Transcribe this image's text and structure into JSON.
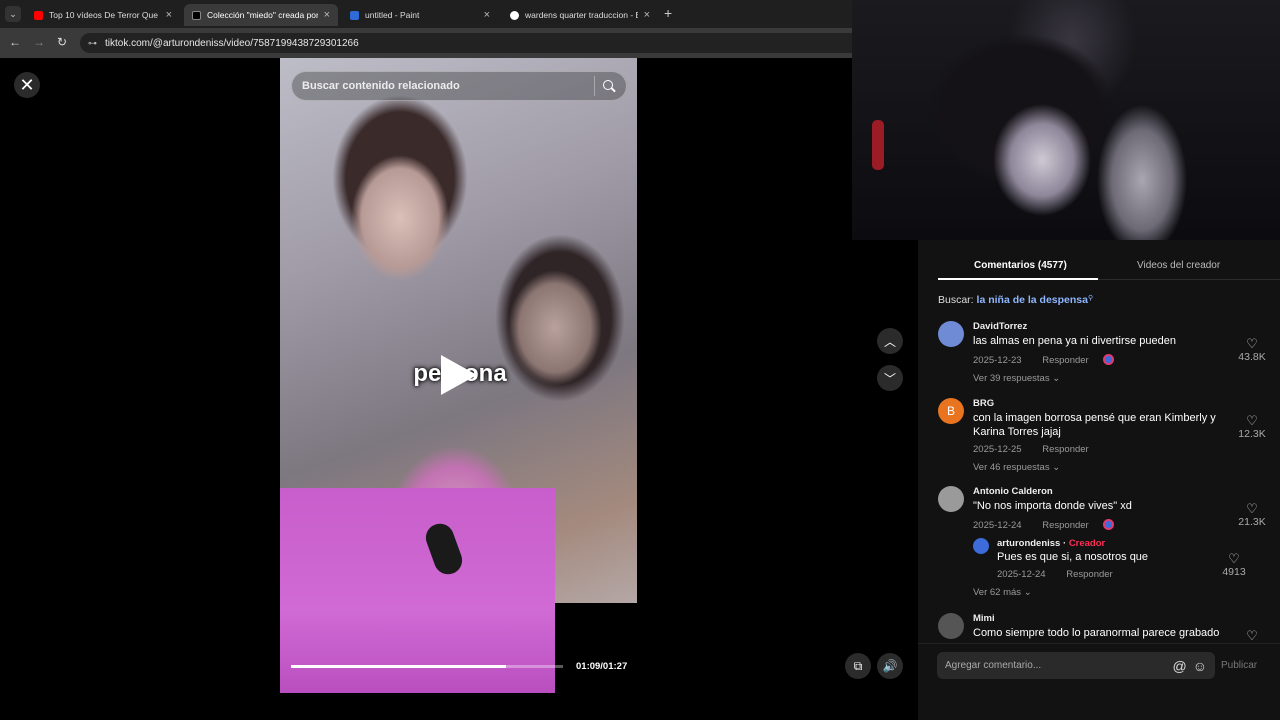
{
  "browser": {
    "tabs": [
      {
        "title": "Top 10 vídeos De Terror Que N",
        "favicon_color": "#ff0000"
      },
      {
        "title": "Colección \"miedo\" creada por",
        "favicon_color": "#000000"
      },
      {
        "title": "untitled - Paint",
        "favicon_color": "#2f6bd8"
      },
      {
        "title": "wardens quarter traduccion - B",
        "favicon_color": "#ffffff"
      }
    ],
    "url": "tiktok.com/@arturondeniss/video/7587199438729301266",
    "nav": {
      "back": "←",
      "forward": "→",
      "reload": "↻",
      "site_info": "⊶",
      "new_tab": "+",
      "tab_menu": "⌄"
    }
  },
  "video": {
    "search_placeholder": "Buscar contenido relacionado",
    "caption": "persona",
    "time": "01:09/01:27",
    "progress_fraction": 0.79
  },
  "controls": {
    "close": "✕",
    "prev": "︿",
    "next": "﹀",
    "volume": "🔊",
    "pip": "⧉"
  },
  "panel": {
    "tab_comments": "Comentarios (4577)",
    "tab_creator": "Videos del creador",
    "search_label": "Buscar:",
    "search_query": "la niña de la despensa",
    "comments": [
      {
        "user": "DavidTorrez",
        "text": "las almas en pena ya ni divertirse pueden",
        "date": "2025-12-23",
        "reply": "Responder",
        "likes": "43.8K",
        "more": "Ver 39 respuestas ⌄",
        "avatar_color": "#6f8bd6",
        "avatar_letter": ""
      },
      {
        "user": "BRG",
        "text": "con la imagen borrosa pensé que eran Kimberly y Karina Torres jajaj",
        "date": "2025-12-25",
        "reply": "Responder",
        "likes": "12.3K",
        "more": "Ver 46 respuestas ⌄",
        "avatar_color": "#e8741f",
        "avatar_letter": "B"
      },
      {
        "user": "Antonio Calderon",
        "text": "\"No nos importa donde vives\" xd",
        "date": "2025-12-24",
        "reply": "Responder",
        "likes": "21.3K",
        "more": "Ver 62 más ⌄",
        "avatar_color": "#9a9a9a",
        "avatar_letter": ""
      },
      {
        "user": "Mimi",
        "text": "Como siempre todo lo paranormal parece grabado",
        "avatar_color": "#555555",
        "avatar_letter": ""
      }
    ],
    "creator_reply": {
      "user": "arturondeniss",
      "sep": " · ",
      "role": "Creador",
      "text": "Pues es que si, a nosotros que",
      "date": "2025-12-24",
      "reply": "Responder",
      "likes": "4913"
    },
    "input_placeholder": "Agregar comentario...",
    "mention_icon": "@",
    "emoji_icon": "☺",
    "publish": "Publicar",
    "heart": "♡"
  }
}
